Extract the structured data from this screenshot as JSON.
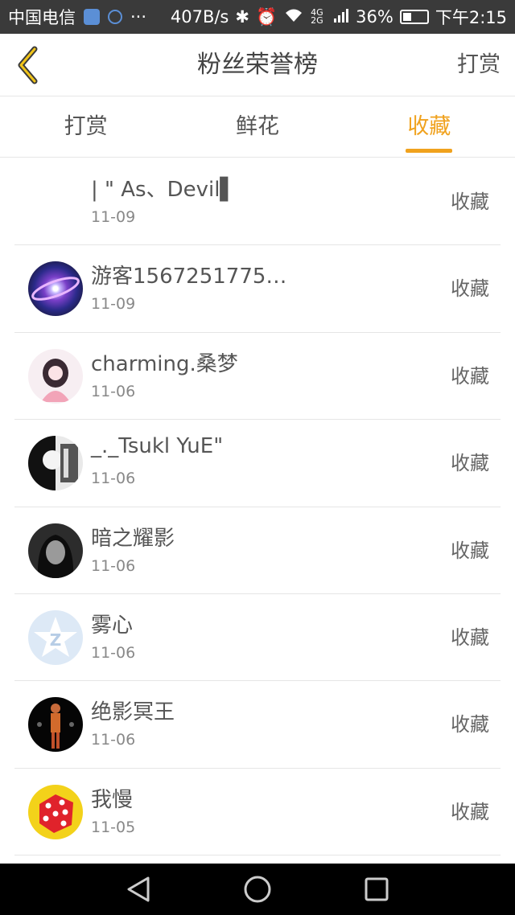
{
  "status_bar": {
    "carrier": "中国电信",
    "dots": "···",
    "net_speed": "407B/s",
    "network": "4G 2G",
    "battery": "36%",
    "battery_level": 0.36,
    "time": "下午2:15"
  },
  "header": {
    "title": "粉丝荣誉榜",
    "action_label": "打赏",
    "back_icon": "chevron-left-icon",
    "accent_color": "#f0a21e"
  },
  "tabs": [
    {
      "label": "打赏",
      "active": false
    },
    {
      "label": "鲜花",
      "active": false
    },
    {
      "label": "收藏",
      "active": true
    }
  ],
  "rows": [
    {
      "name": "| \" As、Devil▌",
      "date": "11-09",
      "action": "收藏",
      "avatar": "none"
    },
    {
      "name": "游客1567251775…",
      "date": "11-09",
      "action": "收藏",
      "avatar": "galaxy"
    },
    {
      "name": "charming.桑梦",
      "date": "11-06",
      "action": "收藏",
      "avatar": "anime-girl"
    },
    {
      "name": "_._Tsukl YuE\"",
      "date": "11-06",
      "action": "收藏",
      "avatar": "monochrome"
    },
    {
      "name": "暗之耀影",
      "date": "11-06",
      "action": "收藏",
      "avatar": "dark-portrait"
    },
    {
      "name": "雾心",
      "date": "11-06",
      "action": "收藏",
      "avatar": "qq-star-logo"
    },
    {
      "name": "绝影冥王",
      "date": "11-06",
      "action": "收藏",
      "avatar": "figure-dark"
    },
    {
      "name": "我慢",
      "date": "11-05",
      "action": "收藏",
      "avatar": "red-dice"
    }
  ],
  "navigation_bar": {
    "back": "triangle-back-icon",
    "home": "circle-home-icon",
    "recents": "square-recents-icon"
  }
}
